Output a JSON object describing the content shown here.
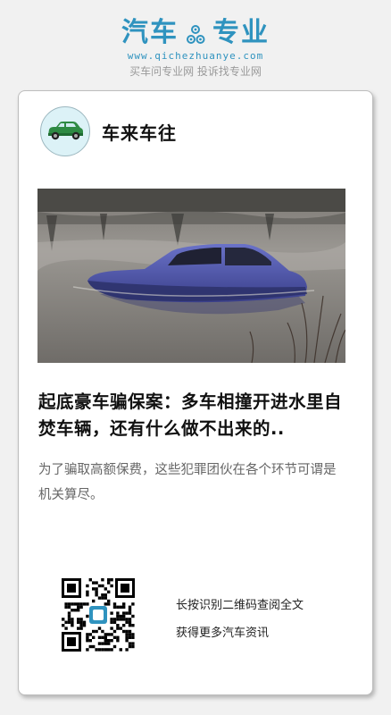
{
  "header": {
    "logo_left": "汽车",
    "logo_right": "专业",
    "gear_icon": "gear-icon",
    "url": "www.qichezhuanye.com",
    "slogan": "买车问专业网 投诉找专业网",
    "brand_color": "#2f93bf"
  },
  "card": {
    "author": {
      "name": "车来车往",
      "avatar_icon": "green-car-avatar"
    },
    "image": {
      "subject": "blue car submerged in a pond"
    },
    "title": "起底豪车骗保案：多车相撞开进水里自焚车辆，还有什么做不出来的..",
    "summary": "为了骗取高额保费，这些犯罪团伙在各个环节可谓是机关算尽。",
    "qr": {
      "icon": "qr-code-icon",
      "line1": "长按识别二维码查阅全文",
      "line2": "获得更多汽车资讯"
    }
  }
}
